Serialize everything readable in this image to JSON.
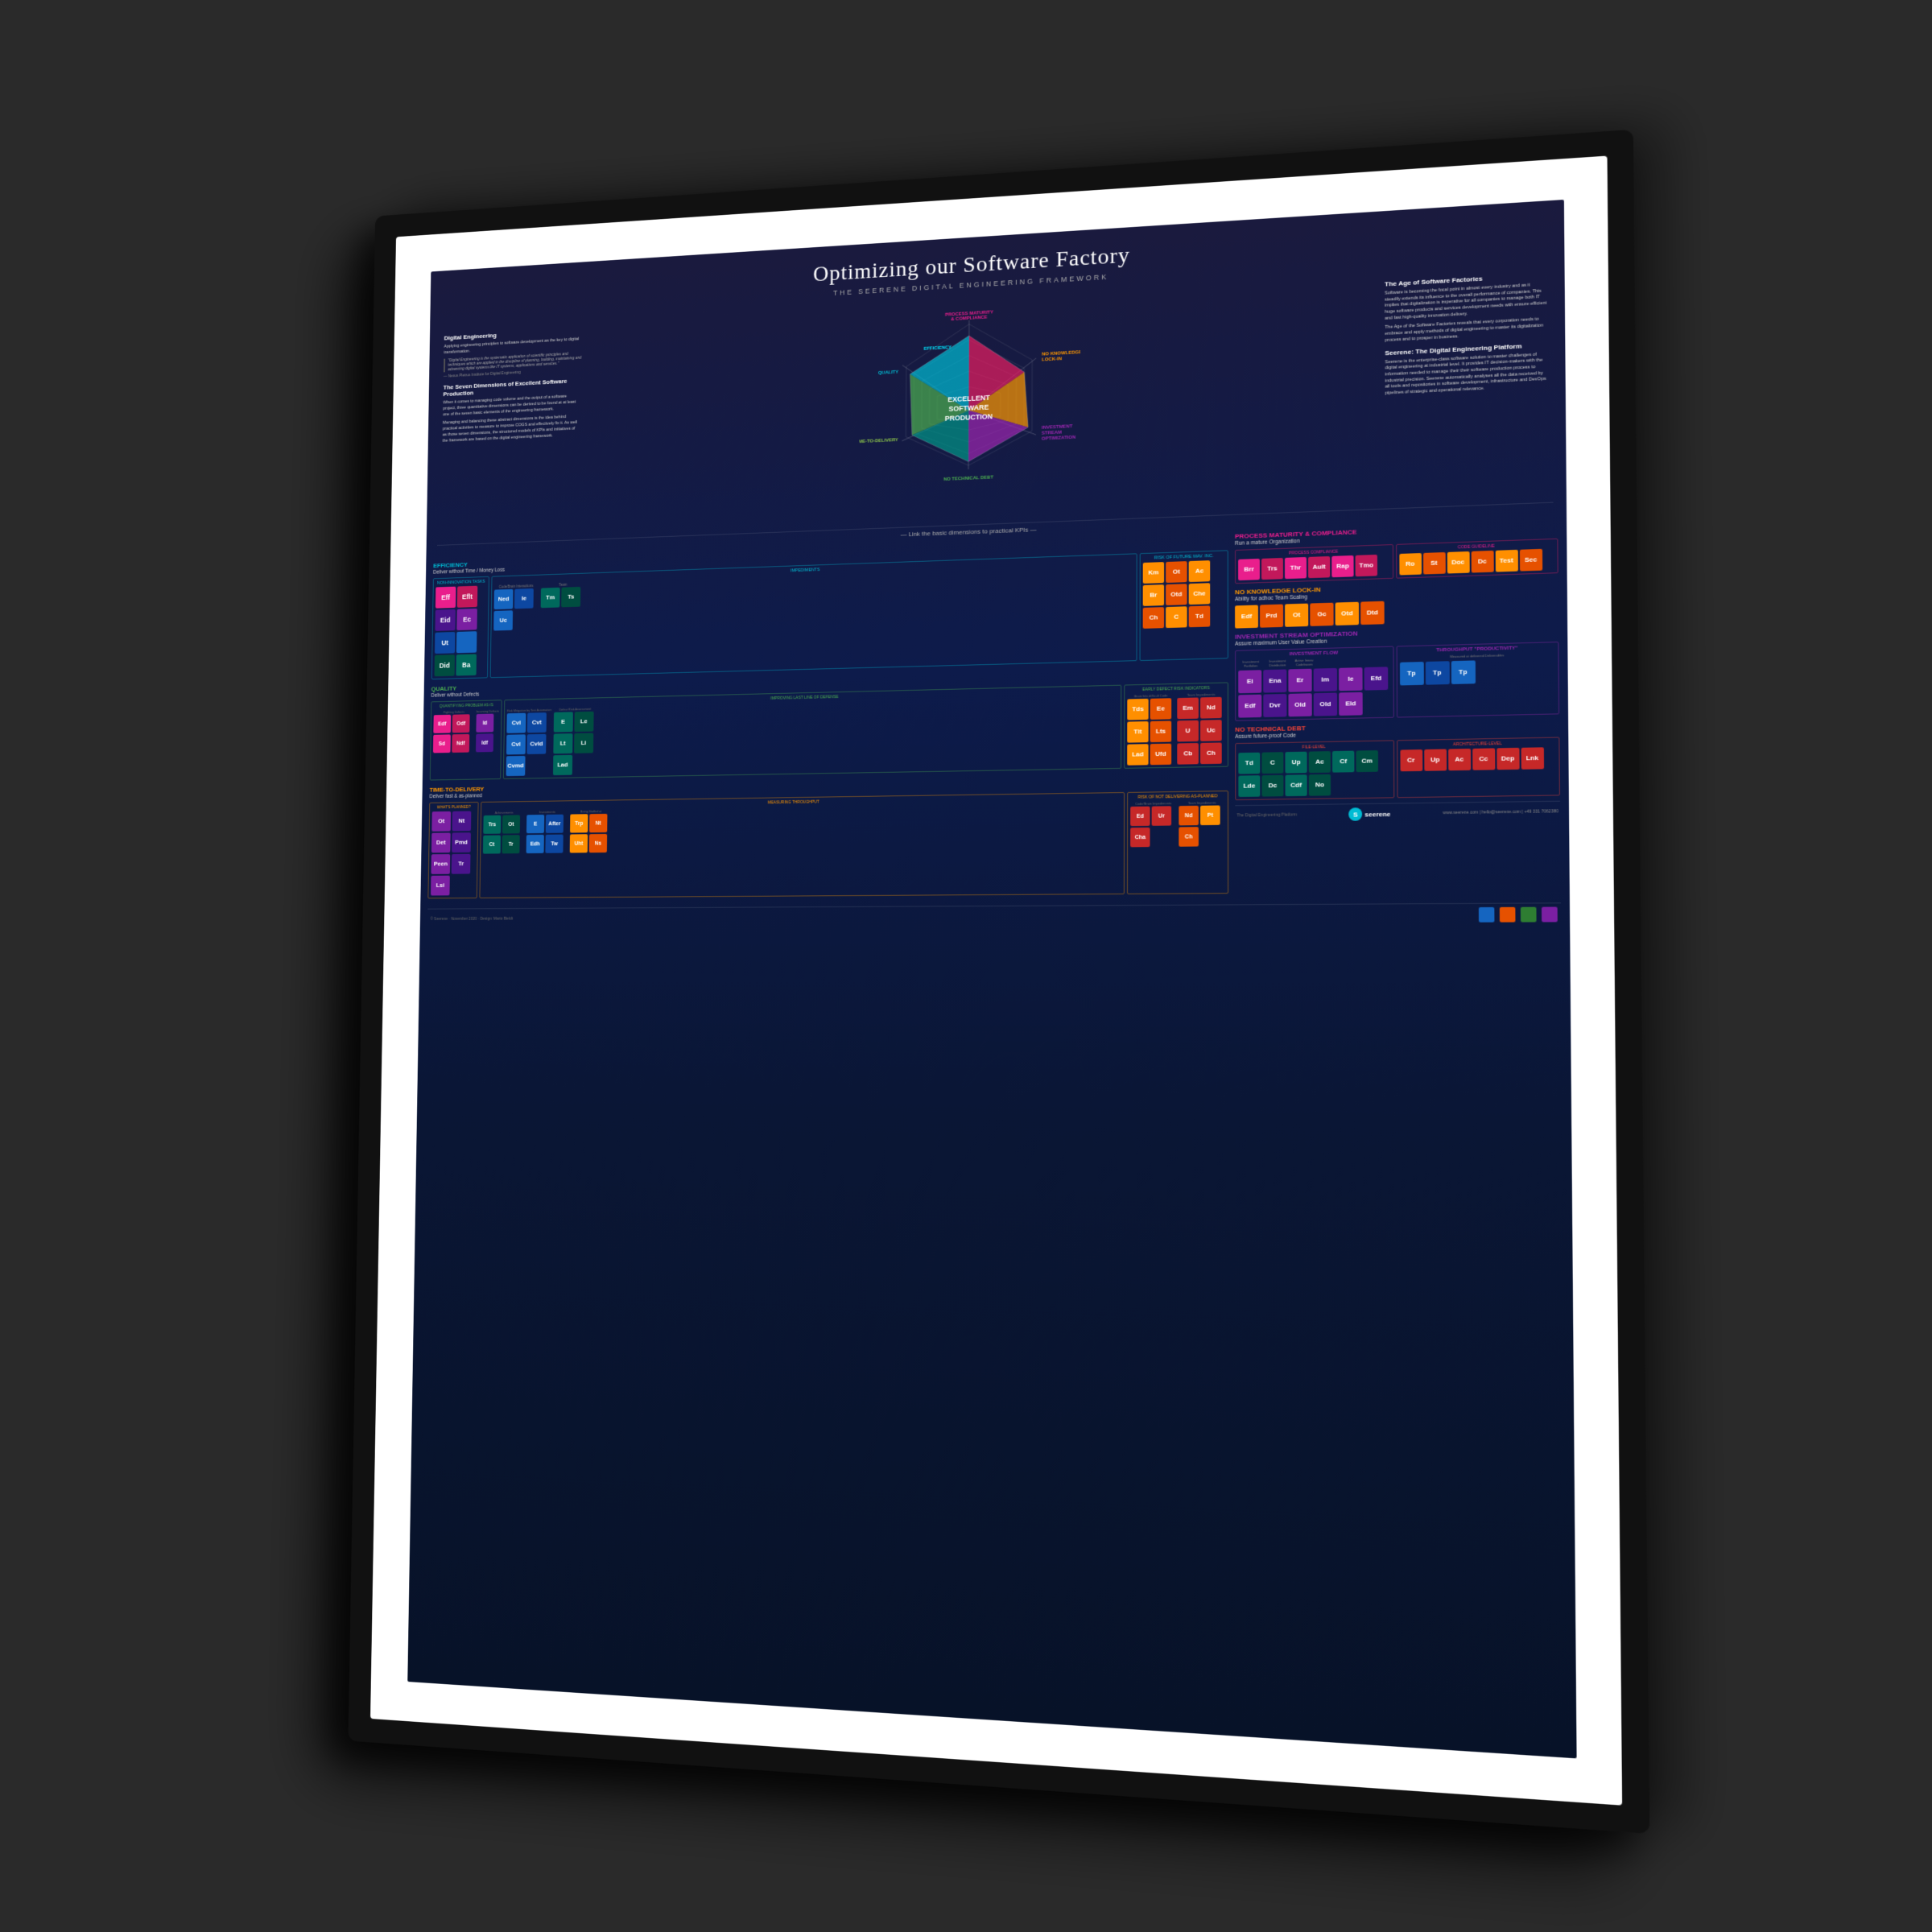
{
  "poster": {
    "title": "Optimizing our Software Factory",
    "subtitle": "THE SEERENE DIGITAL ENGINEERING FRAMEWORK",
    "kpi_link": "— Link the basic dimensions to practical KPIs —",
    "radar_center_line1": "EXCELLENT",
    "radar_center_line2": "SOFTWARE",
    "radar_center_line3": "PRODUCTION",
    "radar_labels": [
      "PROCESS MATURITY & COMPLIANCE",
      "NO KNOWLEDGE LOCK-IN",
      "INVESTMENT STREAM OPTIMIZATION",
      "NO TECHNICAL DEBT",
      "TIME-TO-DELIVERY",
      "QUALITY",
      "EFFICIENCY"
    ],
    "sections": {
      "efficiency": {
        "title": "EFFICIENCY",
        "subtitle": "Deliver without Time / Money Loss"
      },
      "quality": {
        "title": "QUALITY",
        "subtitle": "Deliver without Defects"
      },
      "ttd": {
        "title": "TIME-TO-DELIVERY",
        "subtitle": "Deliver fast & as-planned"
      },
      "pmc": {
        "title": "PROCESS MATURITY & COMPLIANCE",
        "subtitle": "Run a mature Organization"
      },
      "nkl": {
        "title": "NO KNOWLEDGE LOCK-IN",
        "subtitle": "Ability for adhoc Team Scaling"
      },
      "iso": {
        "title": "INVESTMENT STREAM OPTIMIZATION",
        "subtitle": "Assure maximum User Value Creation"
      },
      "ntd": {
        "title": "NO TECHNICAL DEBT",
        "subtitle": "Assure future-proof Code"
      }
    },
    "footer": {
      "copyright": "© Seerene · November 2020 · Design: Mario Bieldt",
      "website": "www.seerene.com | hello@seerene.com | +49 331 7062380"
    }
  }
}
